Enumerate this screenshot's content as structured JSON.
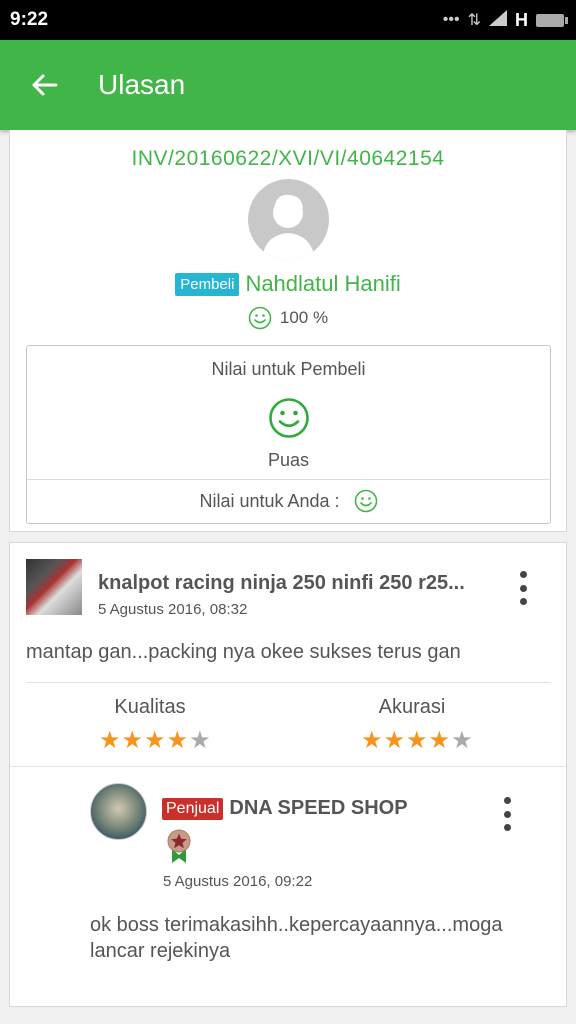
{
  "status_bar": {
    "time": "9:22",
    "network": "H"
  },
  "app_bar": {
    "title": "Ulasan",
    "back_icon": "arrow-left-icon"
  },
  "buyer_card": {
    "invoice": "INV/20160622/XVI/VI/40642154",
    "badge": "Pembeli",
    "name": "Nahdlatul Hanifi",
    "reputation": "100 %",
    "rating_title": "Nilai untuk Pembeli",
    "rating_value": "Puas",
    "rating_for_you": "Nilai untuk Anda :"
  },
  "review": {
    "product_name": "knalpot racing ninja 250 ninfi 250 r25...",
    "date": "5 Agustus 2016, 08:32",
    "text": "mantap gan...packing nya okee sukses terus gan",
    "kualitas_label": "Kualitas",
    "kualitas_stars": 4,
    "akurasi_label": "Akurasi",
    "akurasi_stars": 4,
    "max_stars": 5
  },
  "reply": {
    "badge": "Penjual",
    "seller_name": "DNA SPEED SHOP",
    "date": "5 Agustus 2016, 09:22",
    "text": "ok boss terimakasihh..kepercayaannya...moga lancar rejekinya"
  },
  "colors": {
    "primary": "#42b549",
    "buyer_badge": "#27b5d4",
    "seller_badge": "#c9302c",
    "star_on": "#f7941d",
    "star_off": "#aaaaaa"
  }
}
